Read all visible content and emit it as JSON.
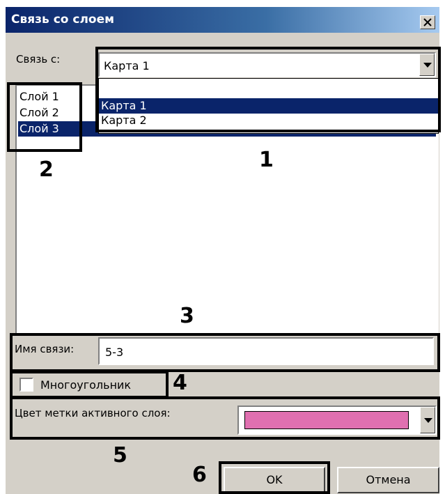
{
  "window": {
    "title": "Связь со слоем"
  },
  "link_with": {
    "label": "Связь с:",
    "selected": "Карта 1",
    "options": [
      "Карта 1",
      "Карта 2"
    ]
  },
  "layers": {
    "items": [
      "Слой 1",
      "Слой 2",
      "Слой 3"
    ],
    "selected_index": 2
  },
  "link_name": {
    "label": "Имя связи:",
    "value": "5-3"
  },
  "polygon": {
    "label": "Многоугольник",
    "checked": false
  },
  "active_layer_color": {
    "label": "Цвет метки активного слоя:",
    "color": "#e070b0"
  },
  "buttons": {
    "ok": "OK",
    "cancel": "Отмена"
  },
  "annotations": [
    "1",
    "2",
    "3",
    "4",
    "5",
    "6"
  ],
  "colors": {
    "selection": "#0a246a",
    "titlebar": "#0a246a",
    "dialog_bg": "#d4d0c8"
  }
}
